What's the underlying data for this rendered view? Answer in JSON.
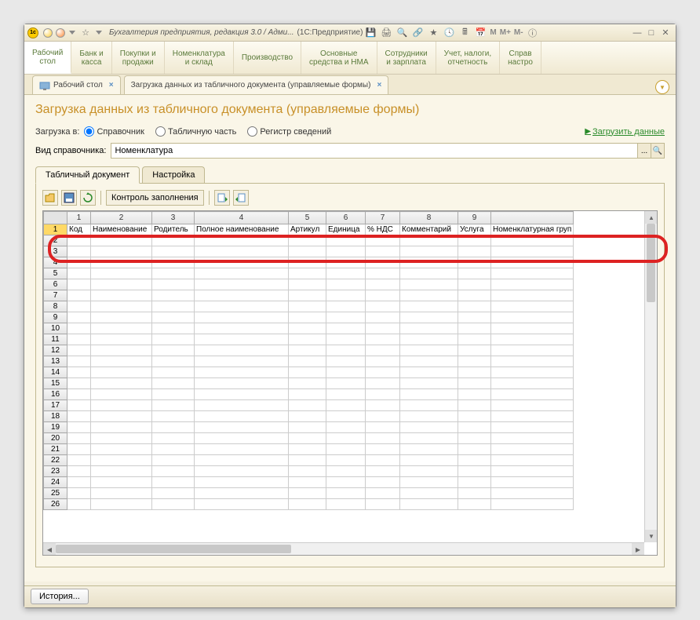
{
  "titlebar": {
    "app_name": "Бухгалтерия предприятия, редакция 3.0 / Адми...",
    "platform": "(1С:Предприятие)",
    "m_labels": [
      "M",
      "M+",
      "M-"
    ]
  },
  "main_nav": [
    "Рабочий\nстол",
    "Банк и\nкасса",
    "Покупки и\nпродажи",
    "Номенклатура\nи склад",
    "Производство",
    "Основные\nсредства и НМА",
    "Сотрудники\nи зарплата",
    "Учет, налоги,\nотчетность",
    "Справ\nнастро"
  ],
  "tabs": [
    {
      "label": "Рабочий стол"
    },
    {
      "label": "Загрузка данных из табличного документа (управляемые формы)"
    }
  ],
  "page_title": "Загрузка данных из табличного документа (управляемые формы)",
  "load_to": {
    "label": "Загрузка в:",
    "options": [
      "Справочник",
      "Табличную часть",
      "Регистр сведений"
    ],
    "link": "Загрузить данные"
  },
  "ref_type": {
    "label": "Вид справочника:",
    "value": "Номенклатура"
  },
  "inner_tabs": [
    "Табличный документ",
    "Настройка"
  ],
  "doc_toolbar": {
    "check_fill": "Контроль заполнения"
  },
  "columns": [
    "1",
    "2",
    "3",
    "4",
    "5",
    "6",
    "7",
    "8",
    "9"
  ],
  "header_row": [
    "Код",
    "Наименование",
    "Родитель",
    "Полное наименование",
    "Артикул",
    "Единица",
    "% НДС",
    "Комментарий",
    "Услуга",
    "Номенклатурная груп"
  ],
  "row_count": 26,
  "history_btn": "История..."
}
